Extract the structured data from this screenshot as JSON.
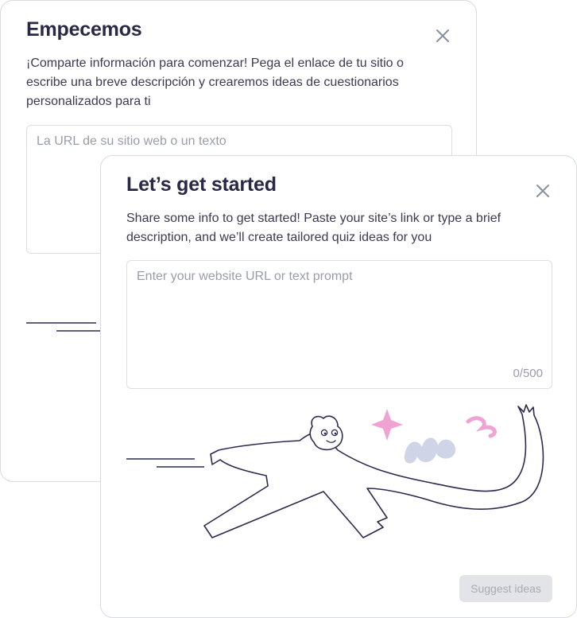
{
  "background_dialog": {
    "title": "Empecemos",
    "description": "¡Comparte información para comenzar! Pega el enlace de tu sitio o escribe una breve descripción y crearemos ideas de cuestionarios personalizados para ti",
    "input_placeholder": "La URL de su sitio web o un texto",
    "input_value": ""
  },
  "dialog": {
    "title": "Let’s get started",
    "description": "Share some info to get started! Paste your site’s link or type a brief description, and we’ll create tailored quiz ideas for you",
    "input_placeholder": "Enter your website URL or text prompt",
    "input_value": "",
    "char_counter": "0/500",
    "suggest_button_label": "Suggest ideas",
    "suggest_button_disabled": true
  },
  "icons": {
    "close": "close-icon",
    "illustration": "running-figure-illustration"
  },
  "colors": {
    "title": "#2a2846",
    "line_art": "#2c2a50",
    "accent_pink": "#f0a3d2",
    "accent_blue": "#cfd4e6",
    "button_disabled_bg": "#e2e4e8",
    "button_disabled_text": "#a8abb5"
  }
}
